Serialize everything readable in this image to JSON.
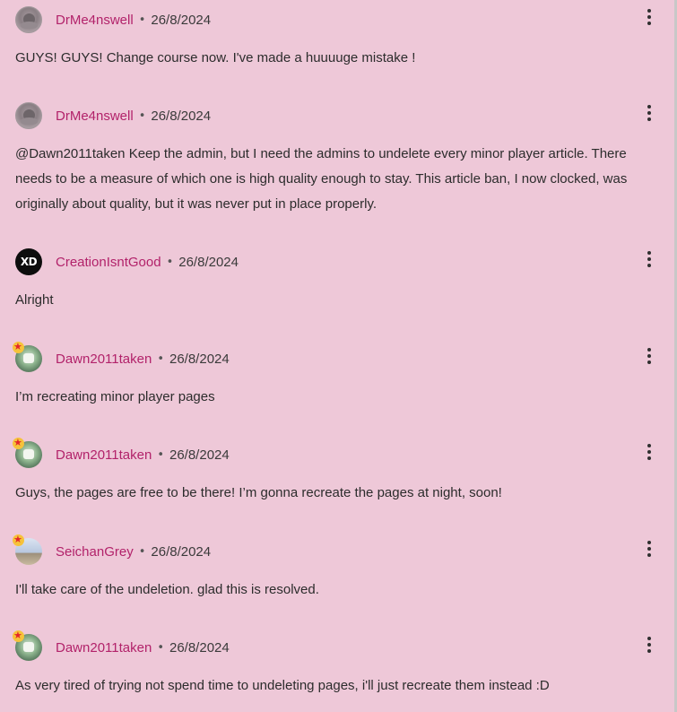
{
  "comments": [
    {
      "username": "DrMe4nswell",
      "date": "26/8/2024",
      "avatar": "gray-owl-avatar",
      "badge": false,
      "text": "GUYS! GUYS! Change course now. I've made a huuuuge mistake !"
    },
    {
      "username": "DrMe4nswell",
      "date": "26/8/2024",
      "avatar": "gray-owl-avatar",
      "badge": false,
      "text": "@Dawn2011taken Keep the admin, but I need the admins to undelete every minor player article. There needs to be a measure of which one is high quality enough to stay. This article ban, I now clocked, was originally about quality, but it was never put in place properly."
    },
    {
      "username": "CreationIsntGood",
      "date": "26/8/2024",
      "avatar": "xd-avatar",
      "avatar_text": "XD",
      "badge": false,
      "text": "Alright"
    },
    {
      "username": "Dawn2011taken",
      "date": "26/8/2024",
      "avatar": "green-avatar",
      "badge": true,
      "text": "I’m recreating minor player pages"
    },
    {
      "username": "Dawn2011taken",
      "date": "26/8/2024",
      "avatar": "green-avatar",
      "badge": true,
      "text": "Guys, the pages are free to be there! I’m gonna recreate the pages at night, soon!"
    },
    {
      "username": "SeichanGrey",
      "date": "26/8/2024",
      "avatar": "sky-avatar",
      "badge": true,
      "text": "I'll take care of the undeletion. glad this is resolved."
    },
    {
      "username": "Dawn2011taken",
      "date": "26/8/2024",
      "avatar": "green-avatar",
      "badge": true,
      "text": "As very tired of trying not spend time to undeleting pages, i'll just recreate them instead :D"
    }
  ],
  "separator": "•",
  "colors": {
    "background": "#eec8d8",
    "username": "#b2226a"
  }
}
